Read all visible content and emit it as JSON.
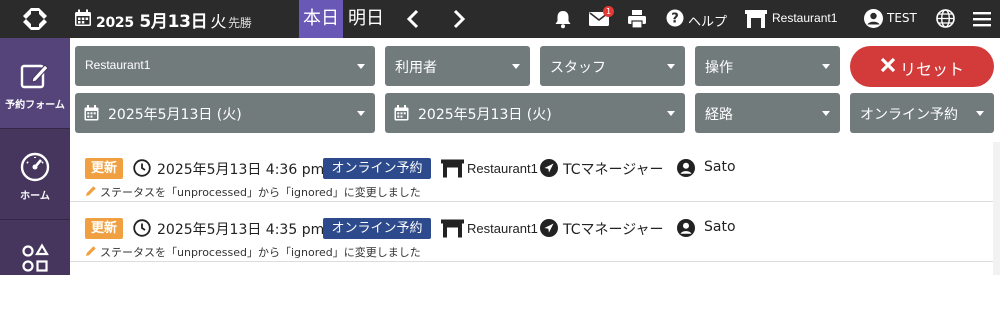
{
  "header": {
    "date_year": "2025",
    "date_md": " 5月13日",
    "weekday": "火",
    "rokuyo": "先勝",
    "tab_today": "本日",
    "tab_tomorrow": "明日",
    "mail_badge": "1",
    "help": "ヘルプ",
    "store": "Restaurant1",
    "user": "TEST"
  },
  "sidebar": {
    "items": [
      {
        "label": "予約フォーム",
        "icon": "edit-icon"
      },
      {
        "label": "ホーム",
        "icon": "gauge-icon"
      },
      {
        "label": "",
        "icon": "apps-icon"
      }
    ]
  },
  "filters": {
    "store": "Restaurant1",
    "user": "利用者",
    "staff": "スタッフ",
    "operation": "操作",
    "date_from": "2025年5月13日 (火)",
    "date_to": "2025年5月13日 (火)",
    "route": "経路",
    "channel": "オンライン予約",
    "reset": "リセット"
  },
  "logs": [
    {
      "badge": "更新",
      "timestamp": "2025年5月13日 4:36 pm",
      "channel": "オンライン予約",
      "store": "Restaurant1",
      "route": "TCマネージャー",
      "user": "Sato",
      "change": "ステータスを「unprocessed」から「ignored」に変更しました"
    },
    {
      "badge": "更新",
      "timestamp": "2025年5月13日 4:35 pm",
      "channel": "オンライン予約",
      "store": "Restaurant1",
      "route": "TCマネージャー",
      "user": "Sato",
      "change": "ステータスを「unprocessed」から「ignored」に変更しました"
    }
  ],
  "colors": {
    "topbar": "#2b2b2b",
    "sidebar": "#46365e",
    "today_tab": "#6a58b7",
    "filter": "#727b7c",
    "reset": "#d33b3b",
    "update_badge": "#f0a040",
    "online_badge": "#2c4a8c"
  }
}
